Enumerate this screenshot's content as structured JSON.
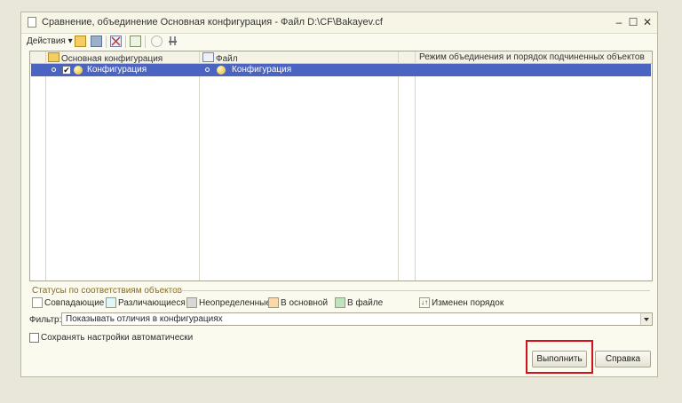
{
  "window": {
    "title": "Сравнение, объединение Основная конфигурация - Файл D:\\CF\\Bakayev.cf",
    "controls": {
      "minimize": "–",
      "maximize": "☐",
      "close": "✕"
    }
  },
  "toolbar": {
    "actions_label": "Действия",
    "actions_arrow": "▾"
  },
  "grid": {
    "columns": [
      "Основная конфигурация",
      "Файл",
      "Режим объединения и порядок подчиненных объектов"
    ],
    "rows": [
      {
        "main": "Конфигурация",
        "file": "Конфигурация",
        "checked": "✔"
      }
    ]
  },
  "legend": {
    "title": "Статусы по соответствиям объектов",
    "items": [
      {
        "label": "Совпадающие",
        "color": "#ffffff"
      },
      {
        "label": "Различающиеся",
        "color": "#dff7fb"
      },
      {
        "label": "Неопределенные",
        "color": "#d8d8d6"
      },
      {
        "label": "В основной",
        "color": "#fbd8a8"
      },
      {
        "label": "В файле",
        "color": "#bfe3bf"
      }
    ],
    "order_changed": "Изменен порядок",
    "order_icon": "↓↑"
  },
  "filter": {
    "label": "Фильтр:",
    "value": "Показывать отличия в конфигурациях"
  },
  "save_settings": {
    "label": "Сохранять настройки автоматически"
  },
  "buttons": {
    "execute": "Выполнить",
    "help": "Справка"
  },
  "colors": {
    "selection": "#4b64c2",
    "highlight": "#d4101b",
    "legend_title": "#8a6a1c"
  }
}
